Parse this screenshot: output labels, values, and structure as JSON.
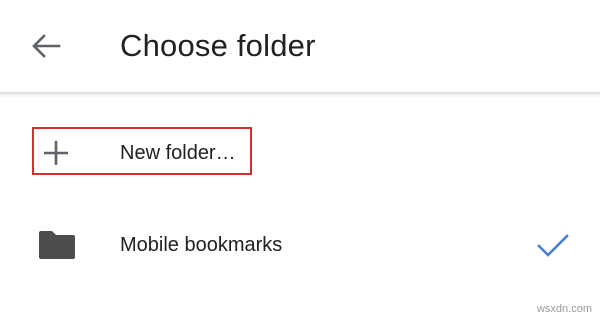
{
  "header": {
    "back_icon": "arrow-back-icon",
    "title": "Choose folder"
  },
  "items": [
    {
      "icon": "plus-icon",
      "label": "New folder…",
      "highlighted": true
    },
    {
      "icon": "folder-icon",
      "label": "Mobile bookmarks",
      "selected": true,
      "selected_icon": "check-icon"
    }
  ],
  "colors": {
    "title_text": "#212121",
    "icon_gray": "#5f6368",
    "folder_fill": "#4d4d4d",
    "check_blue": "#4a7fd6",
    "highlight_border": "#d0312d"
  },
  "watermark": "wsxdn.com"
}
